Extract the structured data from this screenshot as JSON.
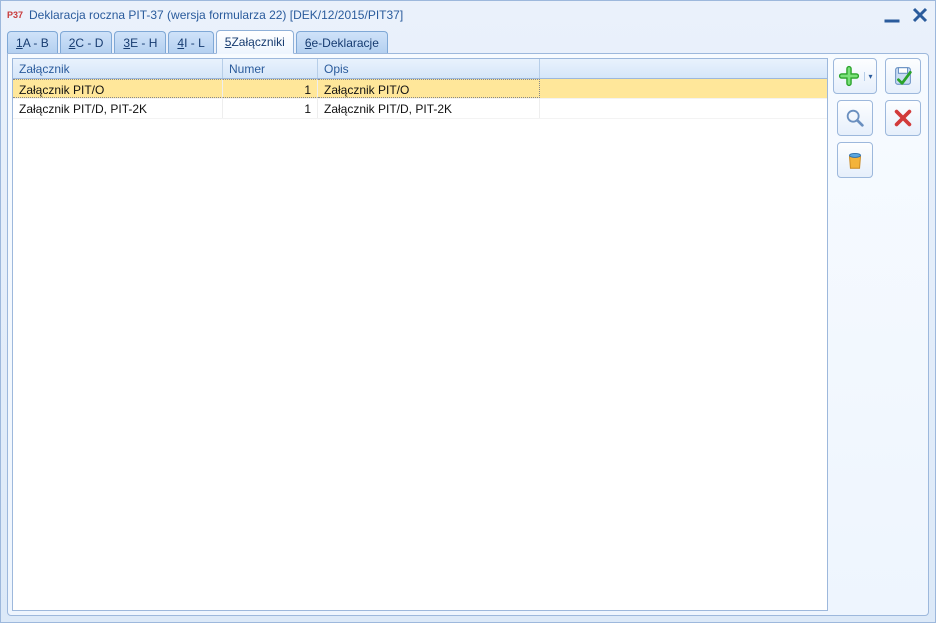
{
  "window": {
    "title": "Deklaracja roczna PIT-37 (wersja formularza 22) [DEK/12/2015/PIT37]",
    "icon_label": "P37"
  },
  "tabs": [
    {
      "mnemonic": "1",
      "label": " A - B"
    },
    {
      "mnemonic": "2",
      "label": " C - D"
    },
    {
      "mnemonic": "3",
      "label": " E - H"
    },
    {
      "mnemonic": "4",
      "label": " I - L"
    },
    {
      "mnemonic": "5",
      "label": " Załączniki",
      "active": true
    },
    {
      "mnemonic": "6",
      "label": " e-Deklaracje"
    }
  ],
  "grid": {
    "columns": {
      "zalacznik": "Załącznik",
      "numer": "Numer",
      "opis": "Opis"
    },
    "rows": [
      {
        "zalacznik": "Załącznik PIT/O",
        "numer": 1,
        "opis": "Załącznik PIT/O",
        "selected": true
      },
      {
        "zalacznik": "Załącznik PIT/D, PIT-2K",
        "numer": 1,
        "opis": "Załącznik PIT/D, PIT-2K",
        "selected": false
      }
    ]
  },
  "toolbar": {
    "add": "Dodaj",
    "magnify": "Podgląd",
    "trash": "Usuń",
    "save": "Zapisz",
    "cancel": "Anuluj"
  }
}
